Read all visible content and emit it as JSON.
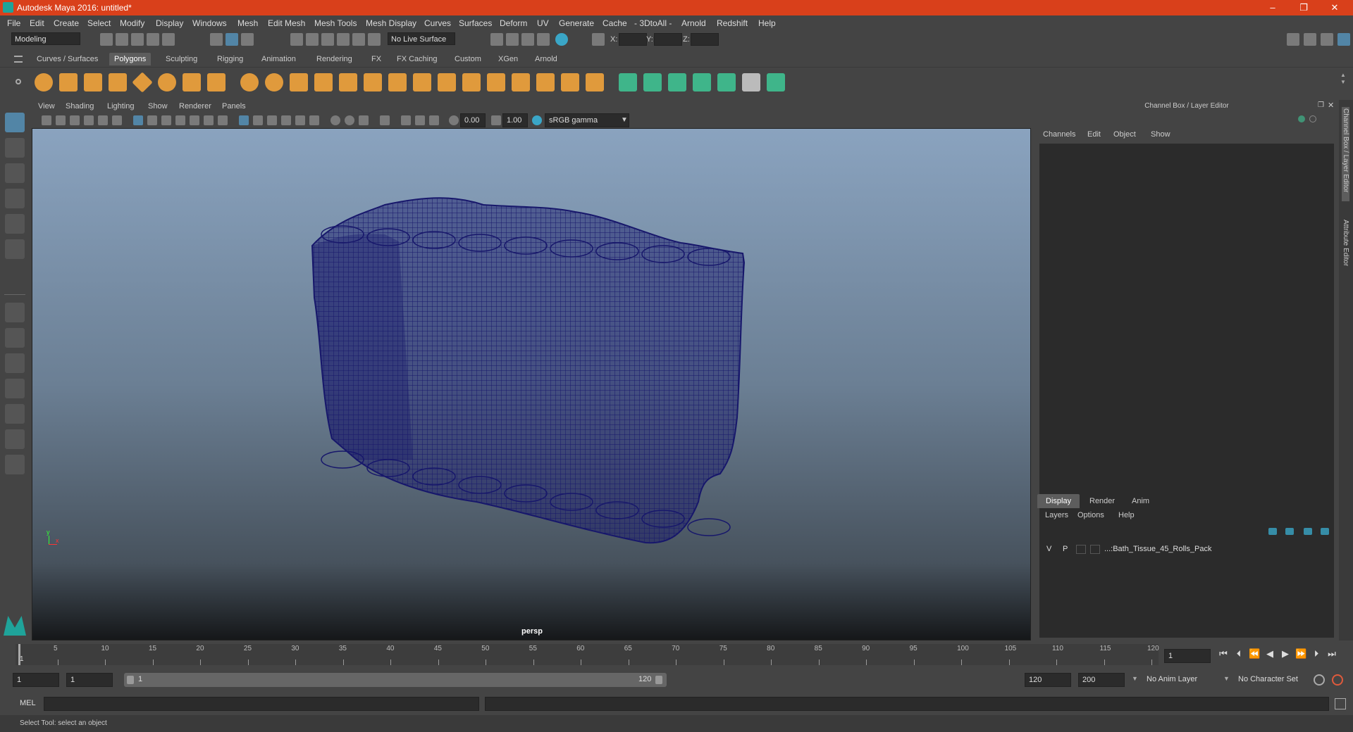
{
  "window": {
    "title": "Autodesk Maya 2016: untitled*",
    "minimize": "–",
    "maximize": "❐",
    "close": "✕"
  },
  "menu": [
    "File",
    "Edit",
    "Create",
    "Select",
    "Modify",
    "Display",
    "Windows",
    "Mesh",
    "Edit Mesh",
    "Mesh Tools",
    "Mesh Display",
    "Curves",
    "Surfaces",
    "Deform",
    "UV",
    "Generate",
    "Cache",
    "- 3DtoAll -",
    "Arnold",
    "Redshift",
    "Help"
  ],
  "statusline": {
    "mode": "Modeling",
    "live_surface": "No Live Surface",
    "x_label": "X:",
    "y_label": "Y:",
    "z_label": "Z:"
  },
  "shelf_tabs": [
    "Curves / Surfaces",
    "Polygons",
    "Sculpting",
    "Rigging",
    "Animation",
    "Rendering",
    "FX",
    "FX Caching",
    "Custom",
    "XGen",
    "Arnold"
  ],
  "shelf_active": "Polygons",
  "viewport": {
    "menu": [
      "View",
      "Shading",
      "Lighting",
      "Show",
      "Renderer",
      "Panels"
    ],
    "exposure": "0.00",
    "gamma": "1.00",
    "color_space": "sRGB gamma",
    "camera": "persp",
    "axis_y": "y",
    "axis_x": "x",
    "mesh_color": "#17176b"
  },
  "channel_box": {
    "header": "Channel Box / Layer Editor",
    "menu": [
      "Channels",
      "Edit",
      "Object",
      "Show"
    ]
  },
  "side_tabs": {
    "channel": "Channel Box / Layer Editor",
    "attribute": "Attribute Editor"
  },
  "layer_editor": {
    "tabs": [
      "Display",
      "Render",
      "Anim"
    ],
    "active_tab": "Display",
    "menu": [
      "Layers",
      "Options",
      "Help"
    ],
    "layers": [
      {
        "v": "V",
        "p": "P",
        "name": "...:Bath_Tissue_45_Rolls_Pack"
      }
    ]
  },
  "timeline": {
    "ticks": [
      "5",
      "10",
      "15",
      "20",
      "25",
      "30",
      "35",
      "40",
      "45",
      "50",
      "55",
      "60",
      "65",
      "70",
      "75",
      "80",
      "85",
      "90",
      "95",
      "100",
      "105",
      "110",
      "115",
      "120"
    ],
    "start_label": "1",
    "current_frame": "1"
  },
  "range": {
    "start": "1",
    "anim_start": "1",
    "slider_start": "1",
    "slider_end": "120",
    "anim_end": "120",
    "end": "200",
    "anim_layer": "No Anim Layer",
    "character_set": "No Character Set"
  },
  "command": {
    "label": "MEL"
  },
  "help_line": "Select Tool: select an object",
  "colors": {
    "titlebar": "#d9401b",
    "accent": "#5285a6",
    "panel": "#444444",
    "field": "#2b2b2b"
  }
}
